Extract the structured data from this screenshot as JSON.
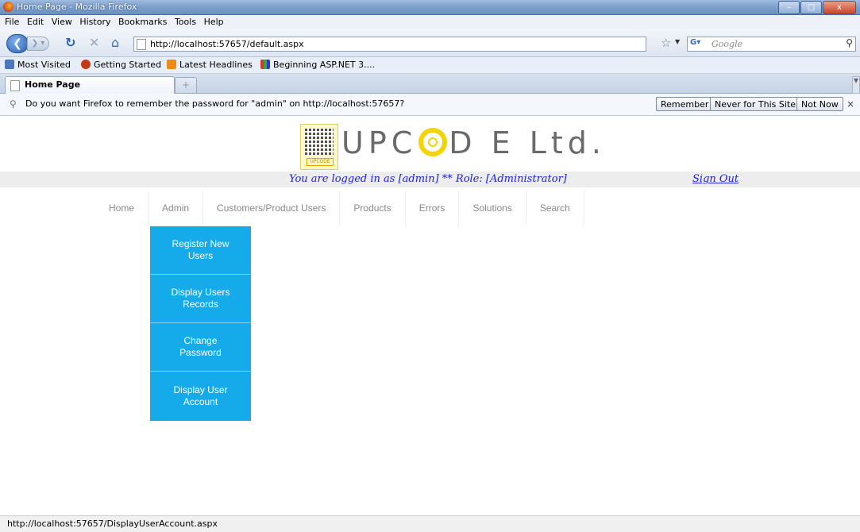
{
  "window": {
    "title": "Home Page - Mozilla Firefox"
  },
  "menubar": [
    "File",
    "Edit",
    "View",
    "History",
    "Bookmarks",
    "Tools",
    "Help"
  ],
  "navbar": {
    "url": "http://localhost:57657/default.aspx",
    "search_placeholder": "Google"
  },
  "bookmarks": [
    "Most Visited",
    "Getting Started",
    "Latest Headlines",
    "Beginning ASP.NET 3...."
  ],
  "tab": {
    "label": "Home Page",
    "newtab": "+"
  },
  "notification": {
    "message": "Do you want Firefox to remember the password for \"admin\" on http://localhost:57657?",
    "buttons": [
      "Remember",
      "Never for This Site",
      "Not Now"
    ],
    "close": "×"
  },
  "logo": {
    "pre": "UPC",
    "post": "D E Ltd.",
    "tag": "UPCODE"
  },
  "login": {
    "text": "You are logged in as [admin] ** Role: [Administrator]",
    "signout": "Sign Out"
  },
  "sitenav": [
    "Home",
    "Admin",
    "Customers/Product Users",
    "Products",
    "Errors",
    "Solutions",
    "Search"
  ],
  "admin_menu": [
    "Register New Users",
    "Display Users Records",
    "Change Password",
    "Display User Account"
  ],
  "status_url": "http://localhost:57657/DisplayUserAccount.aspx",
  "colors": {
    "dropdown": "#15abeb",
    "link": "#1a22d6",
    "logo_accent": "#f4d400"
  }
}
